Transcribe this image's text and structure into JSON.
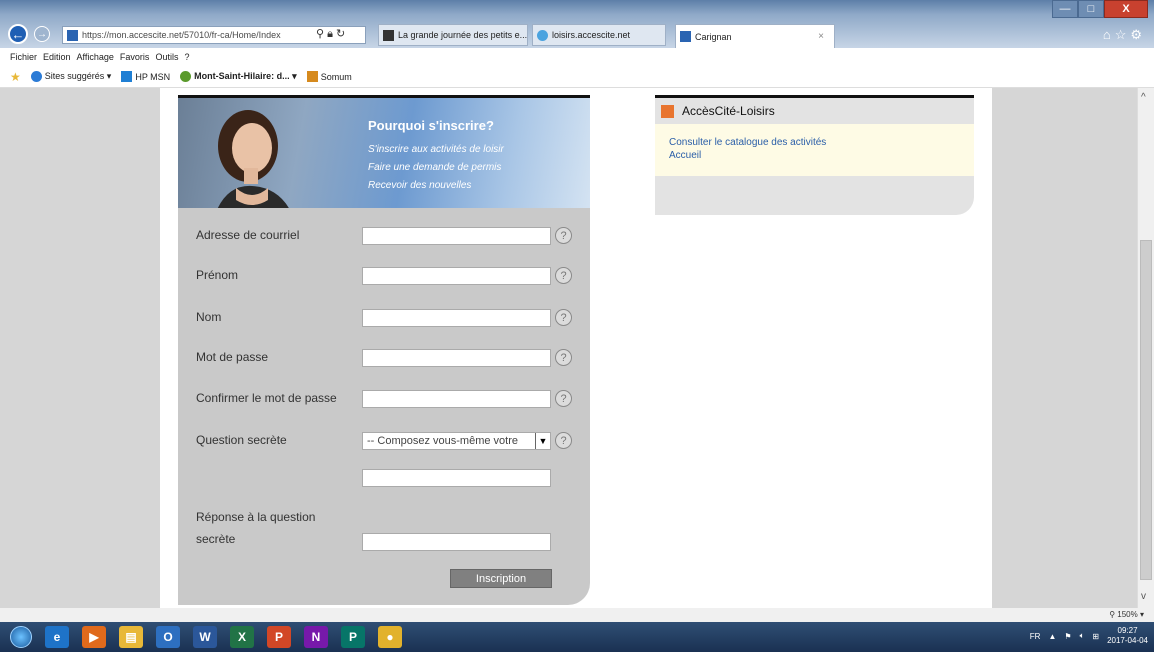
{
  "browser": {
    "address": "https://mon.accescite.net/57010/fr-ca/Home/Index",
    "tabs": [
      {
        "label": "La grande journée des petits e..."
      },
      {
        "label": "loisirs.accescite.net"
      },
      {
        "label": "Carignan",
        "close": "×"
      }
    ],
    "window_controls": {
      "minimize": "—",
      "maximize": "□",
      "close": "X"
    }
  },
  "menu": [
    "Fichier",
    "Edition",
    "Affichage",
    "Favoris",
    "Outils",
    "?"
  ],
  "favorites": [
    {
      "label": "Sites suggérés ▾",
      "color": "#2b7bd6"
    },
    {
      "label": "HP MSN",
      "color": "#1f7fd4"
    },
    {
      "label": "Mont-Saint-Hilaire: d... ▾",
      "color": "#5a9a2b"
    },
    {
      "label": "Somum",
      "color": "#d68a1e"
    }
  ],
  "hero": {
    "title": "Pourquoi s'inscrire?",
    "lines": [
      "S'inscrire aux activités de loisir",
      "Faire une demande de permis",
      "Recevoir des nouvelles"
    ]
  },
  "form": {
    "email_label": "Adresse de courriel",
    "email_value": "",
    "firstname_label": "Prénom",
    "firstname_value": "",
    "lastname_label": "Nom",
    "lastname_value": "",
    "password_label": "Mot de passe",
    "password_value": "",
    "confirm_label": "Confirmer le mot de passe",
    "confirm_value": "",
    "question_label": "Question secrète",
    "question_selected": "-- Composez vous-même votre",
    "custom_question_value": "",
    "answer_label_1": "Réponse à la question",
    "answer_label_2": "secrète",
    "answer_value": "",
    "help_glyph": "?",
    "submit_label": "Inscription"
  },
  "side": {
    "title": "AccèsCité-Loisirs",
    "accent": "#e8742e",
    "links": [
      "Consulter le catalogue des activités",
      "Accueil"
    ]
  },
  "status": {
    "zoom": "150%"
  },
  "taskbar": {
    "apps": [
      {
        "name": "ie",
        "glyph": "e",
        "color": "#1e73c8"
      },
      {
        "name": "media",
        "glyph": "▶",
        "color": "#e06a1c"
      },
      {
        "name": "explorer",
        "glyph": "▤",
        "color": "#e8b838"
      },
      {
        "name": "outlook",
        "glyph": "O",
        "color": "#2d6fc0"
      },
      {
        "name": "word",
        "glyph": "W",
        "color": "#2b579a"
      },
      {
        "name": "excel",
        "glyph": "X",
        "color": "#217346"
      },
      {
        "name": "powerpoint",
        "glyph": "P",
        "color": "#d24726"
      },
      {
        "name": "onenote",
        "glyph": "N",
        "color": "#7719aa"
      },
      {
        "name": "publisher",
        "glyph": "P",
        "color": "#077568"
      },
      {
        "name": "chrome",
        "glyph": "●",
        "color": "#e2b22c"
      }
    ],
    "lang": "FR",
    "time": "09:27",
    "date": "2017-04-04"
  }
}
